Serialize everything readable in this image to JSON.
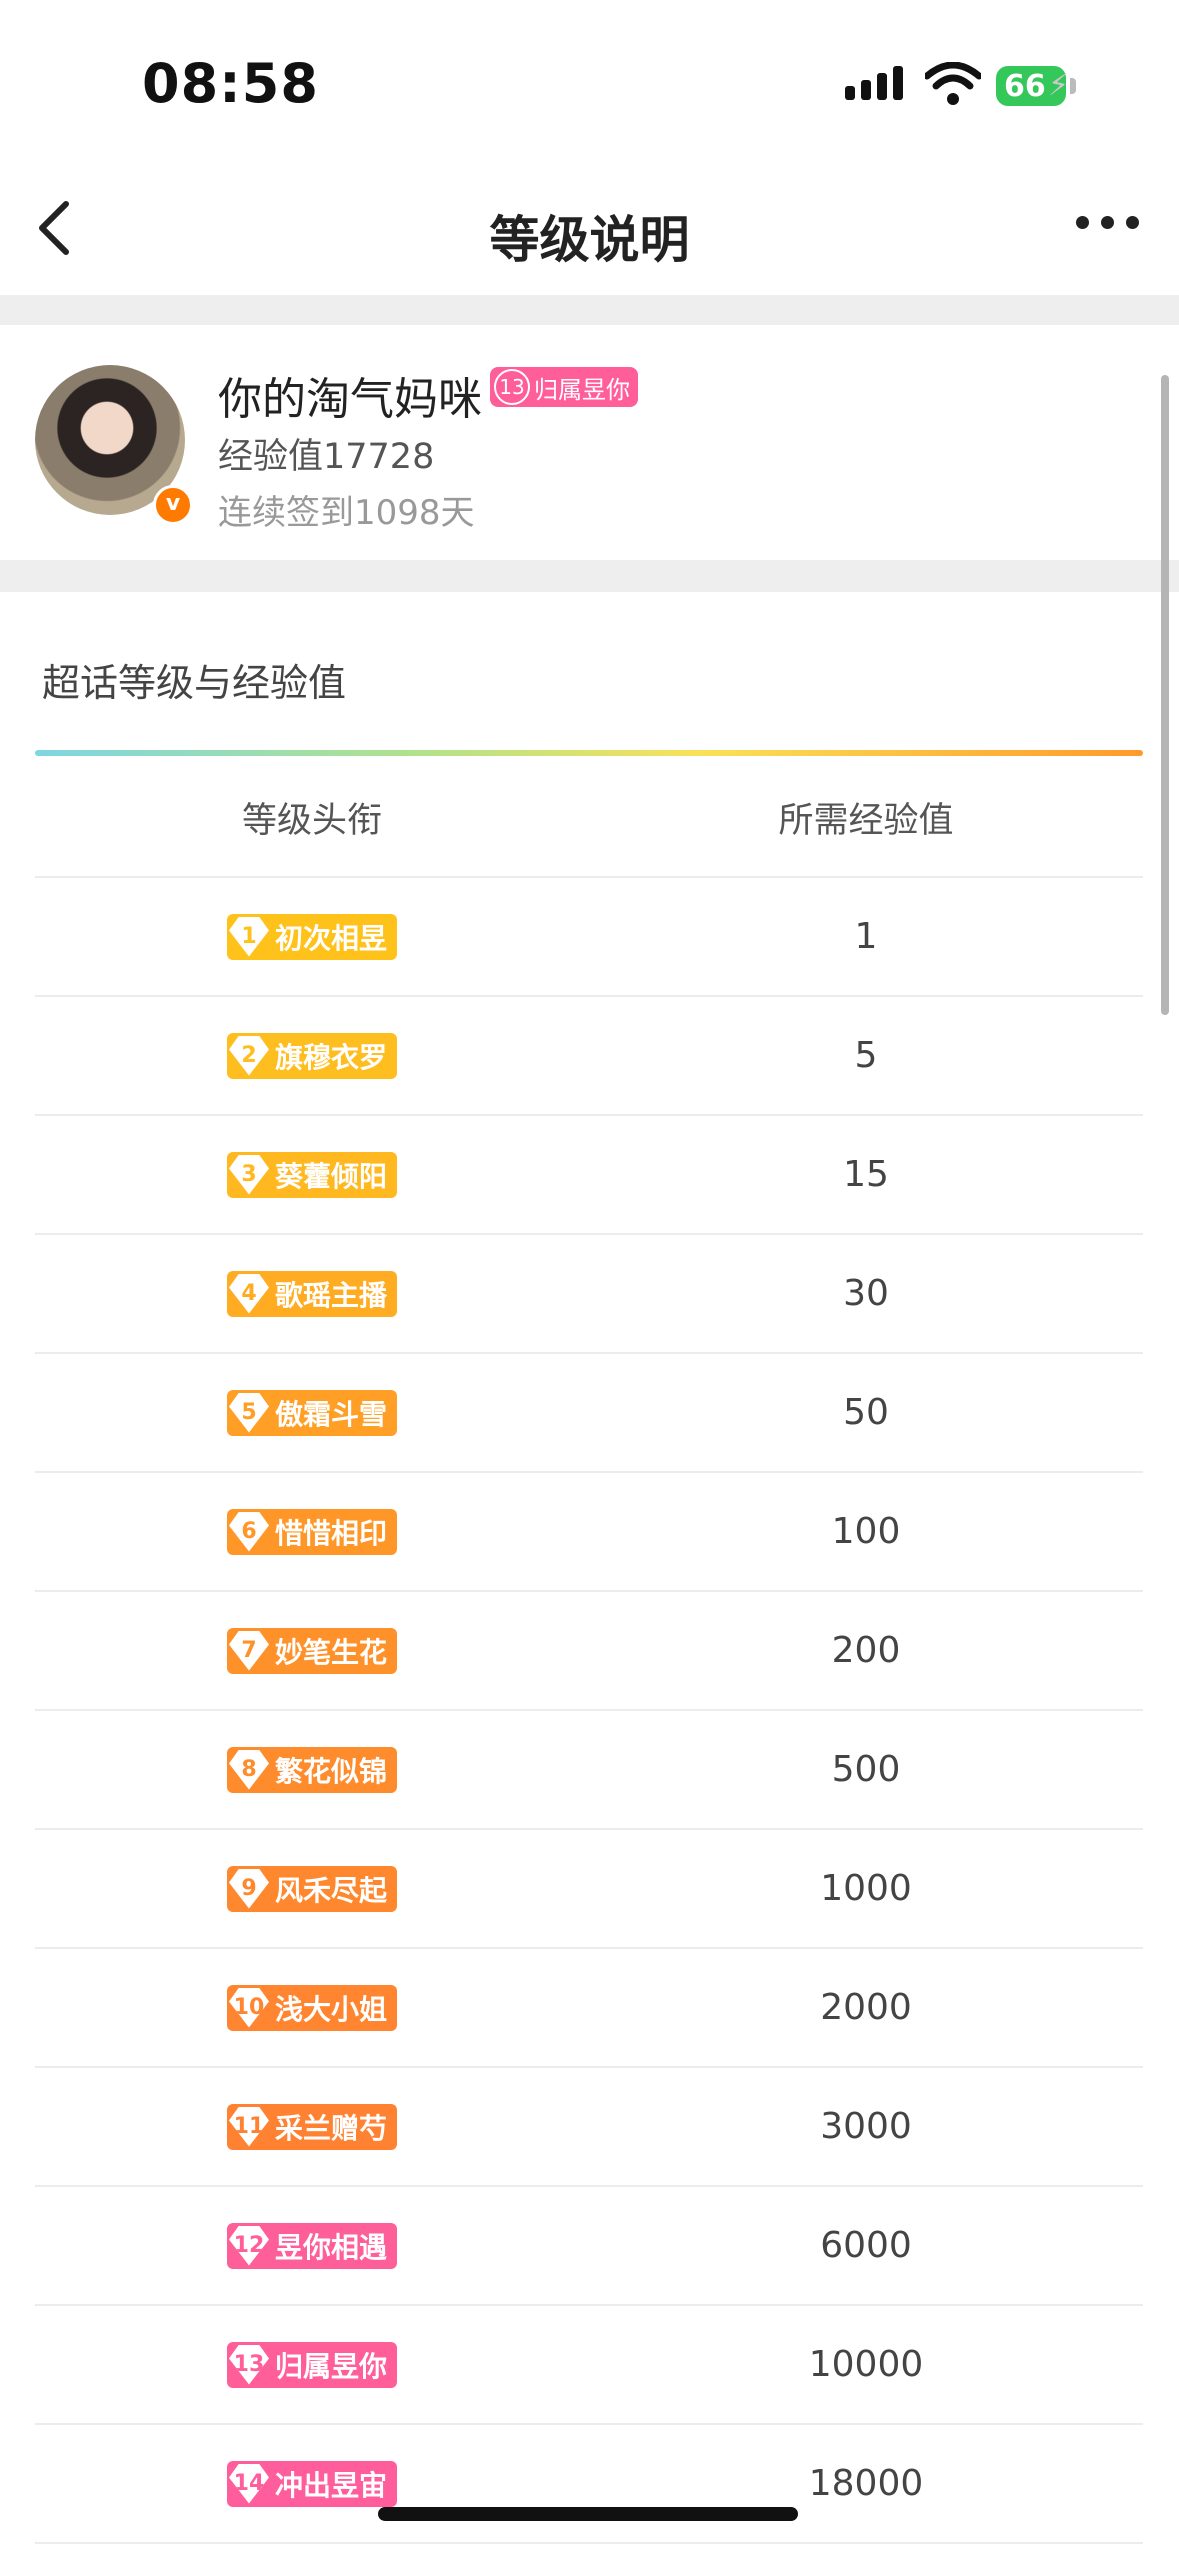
{
  "status_bar": {
    "time": "08:58",
    "battery": "66"
  },
  "nav": {
    "title": "等级说明"
  },
  "profile": {
    "name": "你的淘气妈咪",
    "badge_level": "13",
    "badge_title": "归属昱你",
    "exp_label": "经验值17728",
    "checkin_label": "连续签到1098天"
  },
  "section": {
    "title": "超话等级与经验值",
    "col_title": "等级头衔",
    "col_exp": "所需经验值"
  },
  "levels": [
    {
      "level": "1",
      "title": "初次相昱",
      "exp": "1",
      "color": "#ffc21a"
    },
    {
      "level": "2",
      "title": "旗穆衣罗",
      "exp": "5",
      "color": "#ffbe1f"
    },
    {
      "level": "3",
      "title": "葵藿倾阳",
      "exp": "15",
      "color": "#ffb81f"
    },
    {
      "level": "4",
      "title": "歌瑶主播",
      "exp": "30",
      "color": "#ffac22"
    },
    {
      "level": "5",
      "title": "傲霜斗雪",
      "exp": "50",
      "color": "#ff9f26"
    },
    {
      "level": "6",
      "title": "惜惜相印",
      "exp": "100",
      "color": "#ff9728"
    },
    {
      "level": "7",
      "title": "妙笔生花",
      "exp": "200",
      "color": "#ff912a"
    },
    {
      "level": "8",
      "title": "繁花似锦",
      "exp": "500",
      "color": "#ff8c2c"
    },
    {
      "level": "9",
      "title": "风禾尽起",
      "exp": "1000",
      "color": "#ff882e"
    },
    {
      "level": "10",
      "title": "浅大小姐",
      "exp": "2000",
      "color": "#ff8530"
    },
    {
      "level": "11",
      "title": "采兰赠芍",
      "exp": "3000",
      "color": "#ff8232"
    },
    {
      "level": "12",
      "title": "昱你相遇",
      "exp": "6000",
      "color": "#ff5f98"
    },
    {
      "level": "13",
      "title": "归属昱你",
      "exp": "10000",
      "color": "#ff5e99"
    },
    {
      "level": "14",
      "title": "冲出昱宙",
      "exp": "18000",
      "color": "#ff5d9b"
    }
  ]
}
